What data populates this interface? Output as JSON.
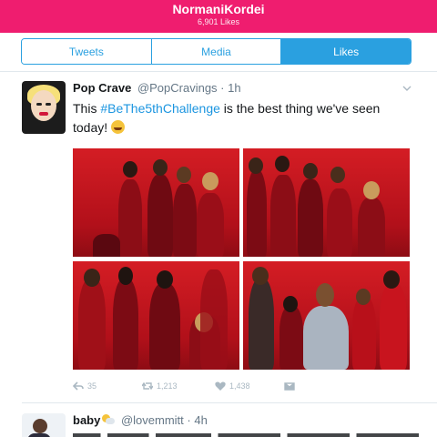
{
  "header": {
    "title": "NormaniKordei",
    "subtitle": "6,901 Likes"
  },
  "tabs": [
    {
      "label": "Tweets",
      "active": false
    },
    {
      "label": "Media",
      "active": false
    },
    {
      "label": "Likes",
      "active": true
    }
  ],
  "tweet1": {
    "display_name": "Pop Crave",
    "handle": "@PopCravings",
    "time": "1h",
    "text_before": "This ",
    "hashtag": "#BeThe5thChallenge",
    "text_after": " is the best thing we've seen today! ",
    "emoji": "joy-emoji",
    "photos": [
      "photo-1",
      "photo-2",
      "photo-3",
      "photo-4"
    ],
    "reply_count": "35",
    "retweet_count": "1,213",
    "like_count": "1,438"
  },
  "tweet2": {
    "display_name": "baby",
    "handle": "@lovemmitt",
    "time": "4h"
  },
  "colors": {
    "header_bg": "#ef1d6f",
    "accent": "#2aa0e0",
    "link": "#1b95e0"
  }
}
